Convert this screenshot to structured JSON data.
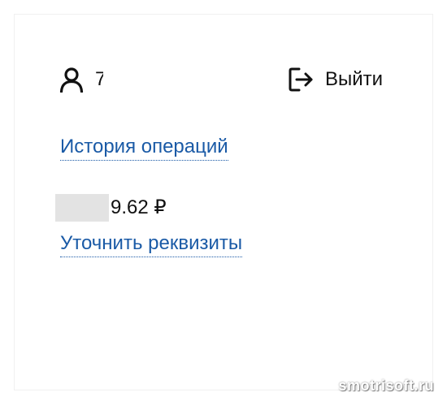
{
  "user": {
    "icon": "user-icon",
    "name_visible": "7"
  },
  "logout": {
    "icon": "logout-icon",
    "label": "Выйти"
  },
  "links": {
    "history": "История операций",
    "details": "Уточнить реквизиты"
  },
  "balance": {
    "value_visible": "9.62 ₽"
  },
  "watermark": "smotrisoft.ru",
  "colors": {
    "link": "#1a5aa6",
    "text": "#111111",
    "mask": "#e3e3e3"
  }
}
